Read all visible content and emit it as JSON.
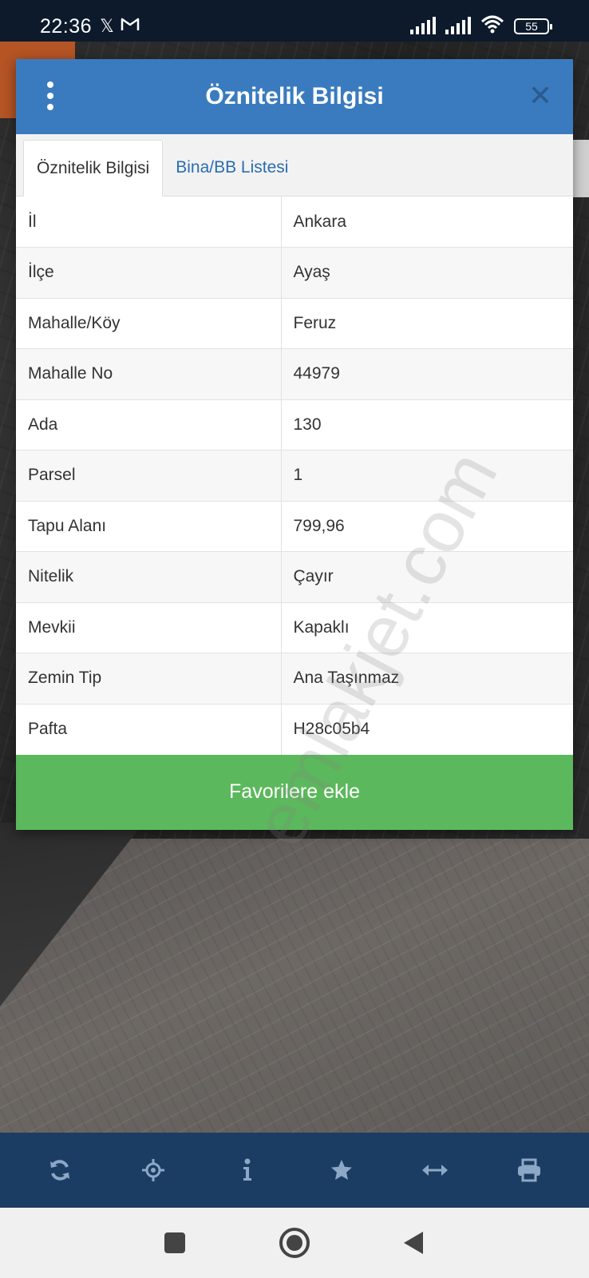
{
  "status_bar": {
    "time": "22:36",
    "left_icons": [
      "x-icon",
      "gmail-icon"
    ],
    "battery": "55"
  },
  "modal": {
    "title": "Öznitelik Bilgisi",
    "tabs": [
      {
        "label": "Öznitelik Bilgisi",
        "active": true
      },
      {
        "label": "Bina/BB Listesi",
        "active": false
      }
    ],
    "rows": [
      {
        "key": "İl",
        "value": "Ankara"
      },
      {
        "key": "İlçe",
        "value": "Ayaş"
      },
      {
        "key": "Mahalle/Köy",
        "value": "Feruz"
      },
      {
        "key": "Mahalle No",
        "value": "44979"
      },
      {
        "key": "Ada",
        "value": "130"
      },
      {
        "key": "Parsel",
        "value": "1"
      },
      {
        "key": "Tapu Alanı",
        "value": "799,96"
      },
      {
        "key": "Nitelik",
        "value": "Çayır"
      },
      {
        "key": "Mevkii",
        "value": "Kapaklı"
      },
      {
        "key": "Zemin Tip",
        "value": "Ana Taşınmaz"
      },
      {
        "key": "Pafta",
        "value": "H28c05b4"
      }
    ],
    "favorite_label": "Favorilere ekle"
  },
  "watermark": "emlakjet.com",
  "toolbar": {
    "items": [
      "refresh-icon",
      "crosshair-icon",
      "info-icon",
      "star-icon",
      "measure-icon",
      "print-icon"
    ]
  },
  "colors": {
    "header": "#3a7bbf",
    "favorite": "#5cb85c",
    "toolbar": "#1c3d63",
    "status_bar": "#0c1a2c"
  }
}
